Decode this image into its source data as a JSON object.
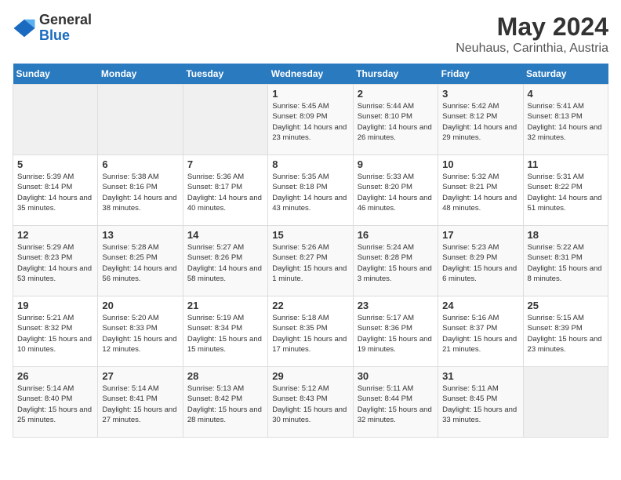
{
  "logo": {
    "text_general": "General",
    "text_blue": "Blue"
  },
  "title": "May 2024",
  "subtitle": "Neuhaus, Carinthia, Austria",
  "days_header": [
    "Sunday",
    "Monday",
    "Tuesday",
    "Wednesday",
    "Thursday",
    "Friday",
    "Saturday"
  ],
  "weeks": [
    [
      {
        "day": "",
        "empty": true
      },
      {
        "day": "",
        "empty": true
      },
      {
        "day": "",
        "empty": true
      },
      {
        "day": "1",
        "sunrise": "5:45 AM",
        "sunset": "8:09 PM",
        "daylight": "14 hours and 23 minutes."
      },
      {
        "day": "2",
        "sunrise": "5:44 AM",
        "sunset": "8:10 PM",
        "daylight": "14 hours and 26 minutes."
      },
      {
        "day": "3",
        "sunrise": "5:42 AM",
        "sunset": "8:12 PM",
        "daylight": "14 hours and 29 minutes."
      },
      {
        "day": "4",
        "sunrise": "5:41 AM",
        "sunset": "8:13 PM",
        "daylight": "14 hours and 32 minutes."
      }
    ],
    [
      {
        "day": "5",
        "sunrise": "5:39 AM",
        "sunset": "8:14 PM",
        "daylight": "14 hours and 35 minutes."
      },
      {
        "day": "6",
        "sunrise": "5:38 AM",
        "sunset": "8:16 PM",
        "daylight": "14 hours and 38 minutes."
      },
      {
        "day": "7",
        "sunrise": "5:36 AM",
        "sunset": "8:17 PM",
        "daylight": "14 hours and 40 minutes."
      },
      {
        "day": "8",
        "sunrise": "5:35 AM",
        "sunset": "8:18 PM",
        "daylight": "14 hours and 43 minutes."
      },
      {
        "day": "9",
        "sunrise": "5:33 AM",
        "sunset": "8:20 PM",
        "daylight": "14 hours and 46 minutes."
      },
      {
        "day": "10",
        "sunrise": "5:32 AM",
        "sunset": "8:21 PM",
        "daylight": "14 hours and 48 minutes."
      },
      {
        "day": "11",
        "sunrise": "5:31 AM",
        "sunset": "8:22 PM",
        "daylight": "14 hours and 51 minutes."
      }
    ],
    [
      {
        "day": "12",
        "sunrise": "5:29 AM",
        "sunset": "8:23 PM",
        "daylight": "14 hours and 53 minutes."
      },
      {
        "day": "13",
        "sunrise": "5:28 AM",
        "sunset": "8:25 PM",
        "daylight": "14 hours and 56 minutes."
      },
      {
        "day": "14",
        "sunrise": "5:27 AM",
        "sunset": "8:26 PM",
        "daylight": "14 hours and 58 minutes."
      },
      {
        "day": "15",
        "sunrise": "5:26 AM",
        "sunset": "8:27 PM",
        "daylight": "15 hours and 1 minute."
      },
      {
        "day": "16",
        "sunrise": "5:24 AM",
        "sunset": "8:28 PM",
        "daylight": "15 hours and 3 minutes."
      },
      {
        "day": "17",
        "sunrise": "5:23 AM",
        "sunset": "8:29 PM",
        "daylight": "15 hours and 6 minutes."
      },
      {
        "day": "18",
        "sunrise": "5:22 AM",
        "sunset": "8:31 PM",
        "daylight": "15 hours and 8 minutes."
      }
    ],
    [
      {
        "day": "19",
        "sunrise": "5:21 AM",
        "sunset": "8:32 PM",
        "daylight": "15 hours and 10 minutes."
      },
      {
        "day": "20",
        "sunrise": "5:20 AM",
        "sunset": "8:33 PM",
        "daylight": "15 hours and 12 minutes."
      },
      {
        "day": "21",
        "sunrise": "5:19 AM",
        "sunset": "8:34 PM",
        "daylight": "15 hours and 15 minutes."
      },
      {
        "day": "22",
        "sunrise": "5:18 AM",
        "sunset": "8:35 PM",
        "daylight": "15 hours and 17 minutes."
      },
      {
        "day": "23",
        "sunrise": "5:17 AM",
        "sunset": "8:36 PM",
        "daylight": "15 hours and 19 minutes."
      },
      {
        "day": "24",
        "sunrise": "5:16 AM",
        "sunset": "8:37 PM",
        "daylight": "15 hours and 21 minutes."
      },
      {
        "day": "25",
        "sunrise": "5:15 AM",
        "sunset": "8:39 PM",
        "daylight": "15 hours and 23 minutes."
      }
    ],
    [
      {
        "day": "26",
        "sunrise": "5:14 AM",
        "sunset": "8:40 PM",
        "daylight": "15 hours and 25 minutes."
      },
      {
        "day": "27",
        "sunrise": "5:14 AM",
        "sunset": "8:41 PM",
        "daylight": "15 hours and 27 minutes."
      },
      {
        "day": "28",
        "sunrise": "5:13 AM",
        "sunset": "8:42 PM",
        "daylight": "15 hours and 28 minutes."
      },
      {
        "day": "29",
        "sunrise": "5:12 AM",
        "sunset": "8:43 PM",
        "daylight": "15 hours and 30 minutes."
      },
      {
        "day": "30",
        "sunrise": "5:11 AM",
        "sunset": "8:44 PM",
        "daylight": "15 hours and 32 minutes."
      },
      {
        "day": "31",
        "sunrise": "5:11 AM",
        "sunset": "8:45 PM",
        "daylight": "15 hours and 33 minutes."
      },
      {
        "day": "",
        "empty": true
      }
    ]
  ]
}
